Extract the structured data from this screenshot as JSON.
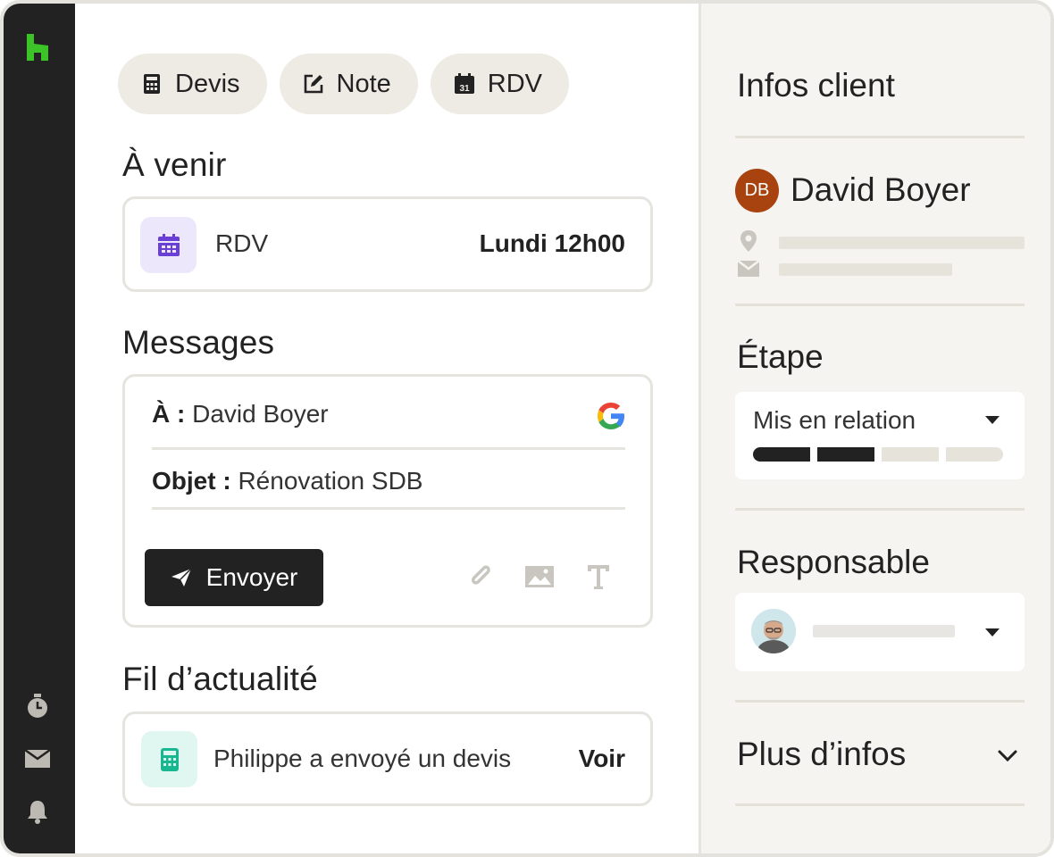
{
  "actions": {
    "quote_label": "Devis",
    "note_label": "Note",
    "appointment_label": "RDV",
    "calendar_day": "31"
  },
  "upcoming": {
    "title": "À venir",
    "item_label": "RDV",
    "item_time": "Lundi 12h00"
  },
  "messages": {
    "title": "Messages",
    "to_label": "À :",
    "to_value": "David Boyer",
    "subject_label": "Objet :",
    "subject_value": "Rénovation SDB",
    "send_label": "Envoyer"
  },
  "feed": {
    "title": "Fil d’actualité",
    "item_text": "Philippe a envoyé un devis",
    "item_link": "Voir"
  },
  "client": {
    "title": "Infos client",
    "initials": "DB",
    "name": "David Boyer"
  },
  "stage": {
    "title": "Étape",
    "value": "Mis en relation",
    "steps_done": 2,
    "steps_total": 4
  },
  "owner": {
    "title": "Responsable"
  },
  "more": {
    "title": "Plus d’infos"
  },
  "colors": {
    "brand_green": "#3cc328",
    "rail_bg": "#222222",
    "appointment_purple": "#6a3fd6",
    "calculator_teal": "#19b78f",
    "avatar_brown": "#a8420f"
  },
  "icons": {
    "rail": [
      "logo-icon",
      "timer-icon",
      "inbox-icon",
      "bell-icon"
    ],
    "tools": [
      "attachment-icon",
      "image-icon",
      "text-format-icon"
    ]
  }
}
